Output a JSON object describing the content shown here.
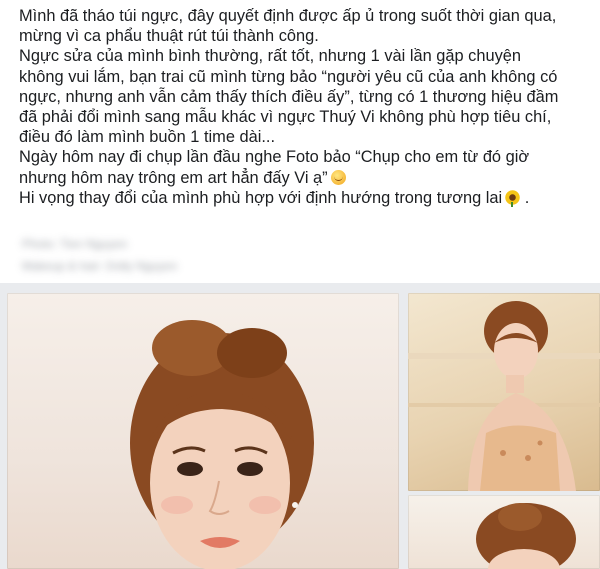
{
  "post": {
    "lines": [
      "Mình đã tháo túi ngực, đây quyết định được ấp ủ trong suốt thời gian qua,",
      "mừng vì ca phẩu thuật rút túi thành công.",
      "Ngực sửa của mình bình thường, rất tốt, nhưng 1 vài lần gặp chuyện",
      "không vui lắm, bạn trai cũ mình từng bảo “người yêu cũ của anh không có",
      "ngực, nhưng anh vẫn cảm thấy thích điều ấy”, từng có 1 thương hiệu đầm",
      "đã phải đổi mình sang mẫu khác vì ngực Thuý Vi không phù hợp tiêu chí,",
      "điều đó làm mình buồn 1 time dài...",
      "Ngày hôm nay đi chụp lần đầu nghe Foto bảo “Chụp cho em từ đó giờ",
      "nhưng hôm nay trông em art hẳn đấy Vi ạ”",
      "Hi vọng thay đổi của mình phù hợp với định hướng trong tương lai"
    ],
    "emoji_line_9": "smile-emoji",
    "emoji_line_10": "sunflower-emoji"
  },
  "credits": {
    "photo": "Photo: Tien Nguyen",
    "makeup": "Makeup & hair: Dolly Nguyen"
  },
  "photos": {
    "main": "portrait-close-up",
    "top_right": "portrait-seated",
    "bottom_right": "portrait-updo"
  },
  "colors": {
    "text": "#1c1e21",
    "photo_bg": "#e9ebee",
    "hair": "#8a4a22",
    "skin": "#f3d2bd",
    "lips": "#e27a64"
  }
}
